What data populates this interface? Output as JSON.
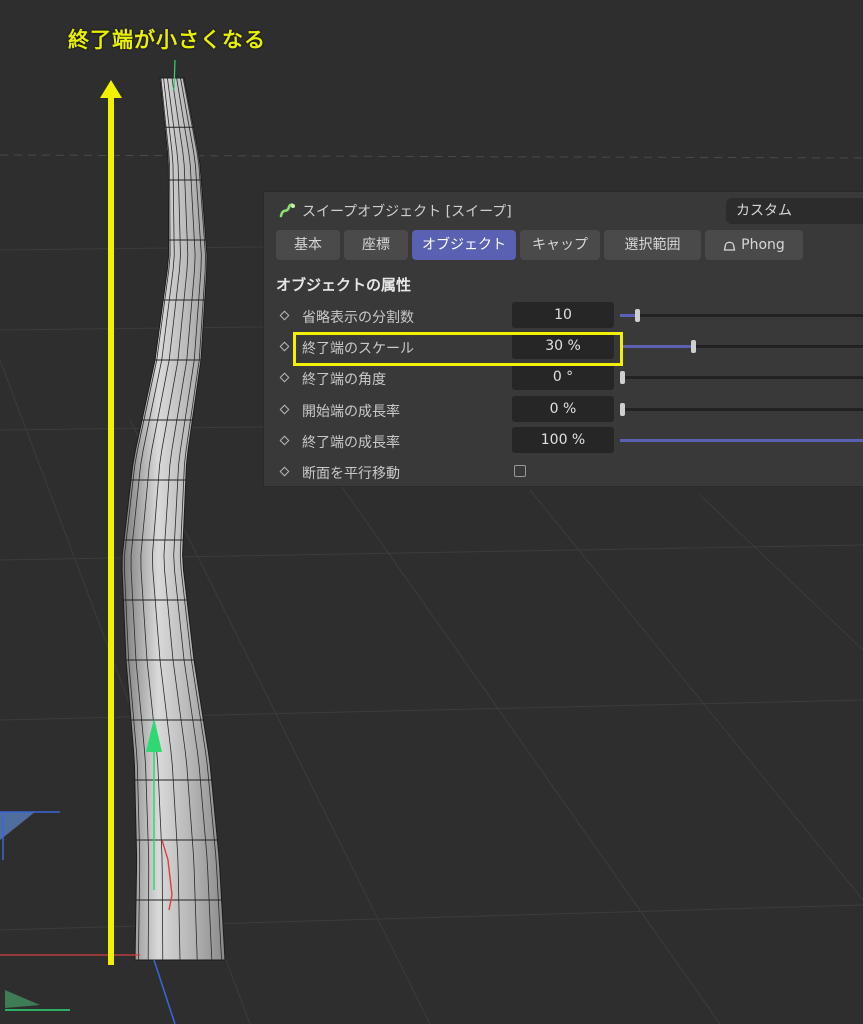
{
  "annotation": {
    "text": "終了端が小さくなる",
    "color": "#e6f000"
  },
  "panel": {
    "title": "スイープオブジェクト [スイープ]",
    "icon": "sweep-icon",
    "mode": "カスタム",
    "tabs": [
      {
        "label": "基本",
        "active": false
      },
      {
        "label": "座標",
        "active": false
      },
      {
        "label": "オブジェクト",
        "active": true
      },
      {
        "label": "キャップ",
        "active": false
      },
      {
        "label": "選択範囲",
        "active": false
      },
      {
        "label": "Phong",
        "active": false,
        "icon": "phong-bell-icon"
      }
    ],
    "section_title": "オブジェクトの属性",
    "params": [
      {
        "label": "省略表示の分割数",
        "value": "10",
        "slider": 0.07
      },
      {
        "label": "終了端のスケール",
        "value": "30 %",
        "slider": 0.3
      },
      {
        "label": "終了端の角度",
        "value": "0 °",
        "slider": 0.0
      },
      {
        "label": "開始端の成長率",
        "value": "0 %",
        "slider": 0.0
      },
      {
        "label": "終了端の成長率",
        "value": "100 %",
        "slider": 1.0
      },
      {
        "label": "断面を平行移動",
        "checkbox": false
      }
    ]
  },
  "colors": {
    "accent": "#5a61b2",
    "highlight": "#f2f200",
    "axis_y": "#2fd873",
    "axis_x": "#d84040",
    "axis_z": "#3a66d8"
  }
}
